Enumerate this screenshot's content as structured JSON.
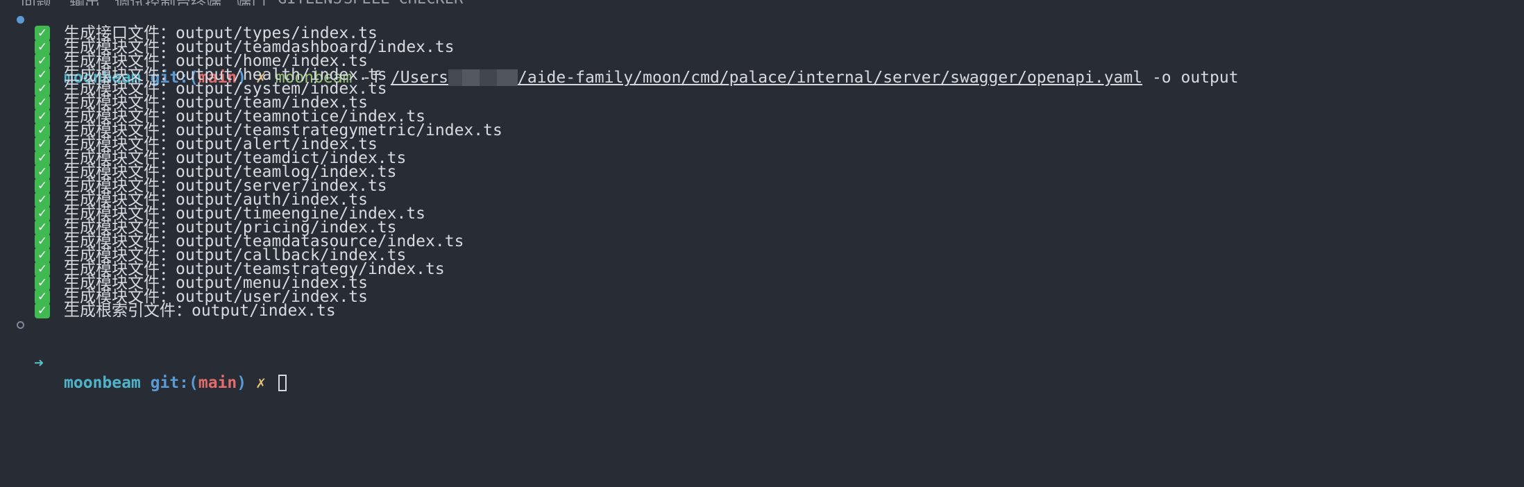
{
  "tabs": [
    "问题",
    "输出",
    "调试控制台",
    "终端",
    "端口",
    "GITLENS",
    "SPELL CHECKER"
  ],
  "colors": {
    "background": "#282c34",
    "prompt_name": "#4fb3c9",
    "git_label": "#5b9bd5",
    "branch": "#e26d6d",
    "dirty_marker": "#e5c07b",
    "command": "#98c379",
    "check_badge": "#3fb950"
  },
  "prompt": {
    "arrow": "➜",
    "dir": "moonbeam",
    "git_label": "git:(",
    "branch": "main",
    "git_close": ")",
    "dirty": "✗"
  },
  "command": {
    "name": "moonbeam",
    "flag_f": "-f",
    "path_start": "/Users",
    "path_rest": "/aide-family/moon/cmd/palace/internal/server/swagger/openapi.yaml",
    "flag_o": "-o",
    "output_arg": "output"
  },
  "output_lines": [
    {
      "label": "生成接口文件：",
      "path": "output/types/index.ts"
    },
    {
      "label": "生成模块文件：",
      "path": "output/teamdashboard/index.ts"
    },
    {
      "label": "生成模块文件：",
      "path": "output/home/index.ts"
    },
    {
      "label": "生成模块文件：",
      "path": "output/health/index.ts"
    },
    {
      "label": "生成模块文件：",
      "path": "output/system/index.ts"
    },
    {
      "label": "生成模块文件：",
      "path": "output/team/index.ts"
    },
    {
      "label": "生成模块文件：",
      "path": "output/teamnotice/index.ts"
    },
    {
      "label": "生成模块文件：",
      "path": "output/teamstrategymetric/index.ts"
    },
    {
      "label": "生成模块文件：",
      "path": "output/alert/index.ts"
    },
    {
      "label": "生成模块文件：",
      "path": "output/teamdict/index.ts"
    },
    {
      "label": "生成模块文件：",
      "path": "output/teamlog/index.ts"
    },
    {
      "label": "生成模块文件：",
      "path": "output/server/index.ts"
    },
    {
      "label": "生成模块文件：",
      "path": "output/auth/index.ts"
    },
    {
      "label": "生成模块文件：",
      "path": "output/timeengine/index.ts"
    },
    {
      "label": "生成模块文件：",
      "path": "output/pricing/index.ts"
    },
    {
      "label": "生成模块文件：",
      "path": "output/teamdatasource/index.ts"
    },
    {
      "label": "生成模块文件：",
      "path": "output/callback/index.ts"
    },
    {
      "label": "生成模块文件：",
      "path": "output/teamstrategy/index.ts"
    },
    {
      "label": "生成模块文件：",
      "path": "output/menu/index.ts"
    },
    {
      "label": "生成模块文件：",
      "path": "output/user/index.ts"
    },
    {
      "label": "生成根索引文件：",
      "path": "output/index.ts"
    }
  ],
  "check_icon": "✓"
}
